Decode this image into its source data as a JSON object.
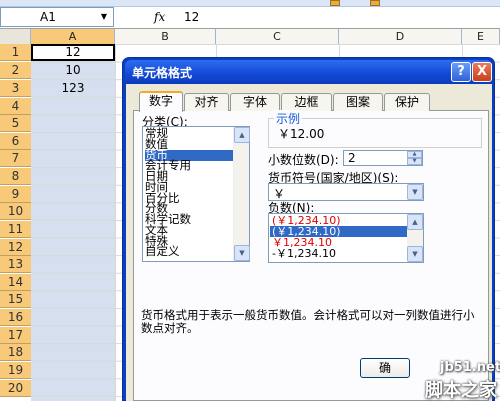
{
  "formula_bar": {
    "name_box": "A1",
    "fx": "fx",
    "value": "12"
  },
  "columns": [
    "A",
    "B",
    "C",
    "D",
    "E"
  ],
  "rows": [
    "1",
    "2",
    "3",
    "4",
    "5",
    "6",
    "7",
    "8",
    "9",
    "10",
    "11",
    "12",
    "13",
    "14",
    "15",
    "16",
    "17",
    "18",
    "19",
    "20"
  ],
  "cells": {
    "A1": "12",
    "A2": "10",
    "A3": "123"
  },
  "dialog": {
    "title": "单元格格式",
    "help": "?",
    "close": "X",
    "tabs": [
      "数字",
      "对齐",
      "字体",
      "边框",
      "图案",
      "保护"
    ],
    "active_tab": "数字",
    "category_label": "分类(C):",
    "categories": [
      "常规",
      "数值",
      "货币",
      "会计专用",
      "日期",
      "时间",
      "百分比",
      "分数",
      "科学记数",
      "文本",
      "特殊",
      "自定义"
    ],
    "selected_category": "货币",
    "sample_label": "示例",
    "sample_value": "￥12.00",
    "decimals_label": "小数位数(D):",
    "decimals_value": "2",
    "currency_label": "货币符号(国家/地区)(S):",
    "currency_value": "￥",
    "negative_label": "负数(N):",
    "negative_options": [
      "(￥1,234.10)",
      "(￥1,234.10)",
      "￥1,234.10",
      "-￥1,234.10"
    ],
    "description": "货币格式用于表示一般货币数值。会计格式可以对一列数值进行小数点对齐。",
    "ok_button": "确"
  },
  "watermark": {
    "line1": "jb51.net",
    "line2": "脚本之家"
  },
  "colors": {
    "titlebar": "#1248d4",
    "selection": "#316ac5",
    "row_header": "#f9c97a",
    "negative_red": "#e00000"
  }
}
